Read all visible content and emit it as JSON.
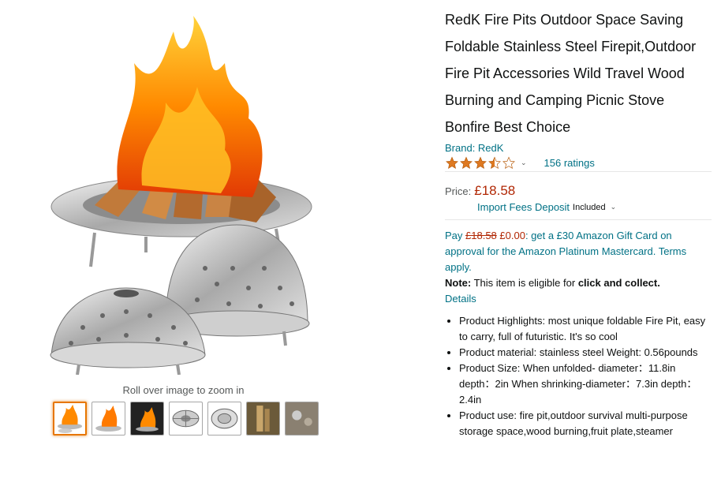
{
  "product": {
    "title": "RedK Fire Pits Outdoor Space Saving Foldable Stainless Steel Firepit,Outdoor Fire Pit Accessories Wild Travel Wood Burning and Camping Picnic Stove Bonfire Best Choice",
    "brand": "Brand: RedK",
    "rating": 3.5,
    "ratings_text": "156 ratings",
    "price_label": "Price:",
    "price": "£18.58",
    "import_fees": "Import Fees Deposit",
    "import_included": "Included"
  },
  "promo": {
    "pay": "Pay ",
    "old_price": "£18.58",
    "new_price": " £0.00",
    "rest": ": get a £30 Amazon Gift Card on approval for the Amazon Platinum Mastercard. Terms apply."
  },
  "note": {
    "label": "Note:",
    "text": " This item is eligible for ",
    "bold": "click and collect.",
    "details": "Details"
  },
  "bullets": [
    "Product Highlights: most unique foldable Fire Pit, easy to carry, full of futuristic. It's so cool",
    "Product material: stainless steel Weight: 0.56pounds",
    "Product Size: When unfolded- diameter：11.8in depth：2in When shrinking-diameter：7.3in depth：2.4in",
    "Product use: fire pit,outdoor survival multi-purpose storage space,wood burning,fruit plate,steamer"
  ],
  "gallery": {
    "zoom_hint": "Roll over image to zoom in",
    "thumbnails": [
      "fire-pit-flames",
      "fire-pit-flames-2",
      "fire-pit-dark",
      "steel-basket-top",
      "steel-basket-flat",
      "person-wood",
      "camp-ground"
    ]
  },
  "colors": {
    "link": "#007185",
    "price": "#b12704",
    "star": "#de7921",
    "thumb_active": "#e77600"
  }
}
